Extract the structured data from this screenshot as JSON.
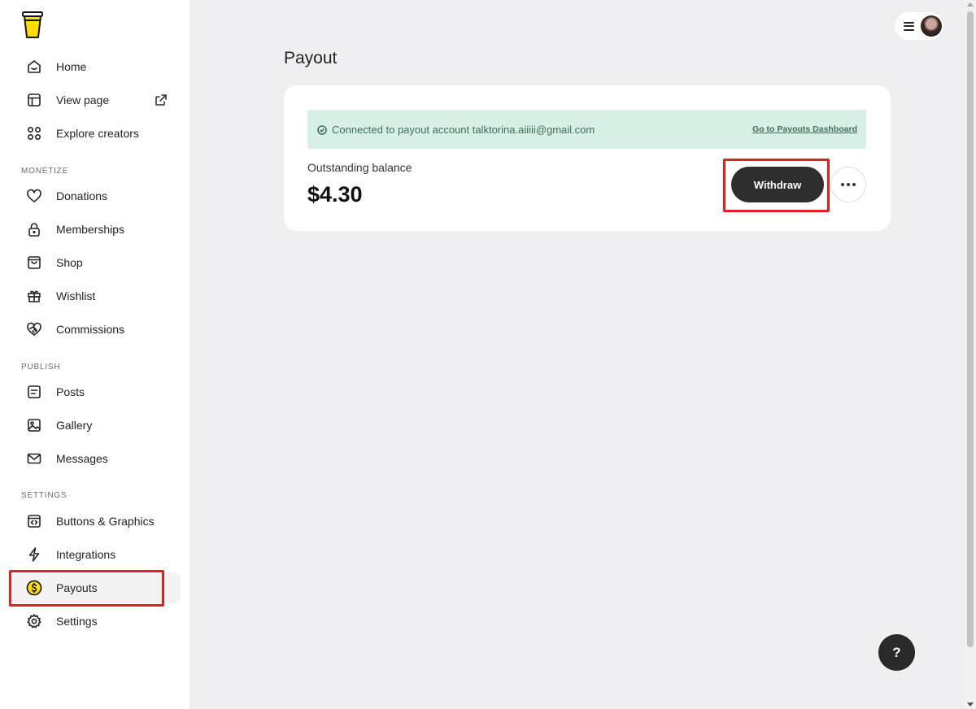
{
  "sidebar": {
    "logo": "buy-me-a-coffee-cup-logo",
    "top_items": [
      {
        "label": "Home",
        "icon": "home-icon"
      },
      {
        "label": "View page",
        "icon": "layout-icon"
      },
      {
        "label": "Explore creators",
        "icon": "grid-circles-icon"
      }
    ],
    "sections": [
      {
        "title": "MONETIZE",
        "items": [
          {
            "label": "Donations",
            "icon": "heart-icon"
          },
          {
            "label": "Memberships",
            "icon": "lock-icon"
          },
          {
            "label": "Shop",
            "icon": "shopping-bag-icon"
          },
          {
            "label": "Wishlist",
            "icon": "gift-icon"
          },
          {
            "label": "Commissions",
            "icon": "handshake-icon"
          }
        ]
      },
      {
        "title": "PUBLISH",
        "items": [
          {
            "label": "Posts",
            "icon": "document-icon"
          },
          {
            "label": "Gallery",
            "icon": "image-icon"
          },
          {
            "label": "Messages",
            "icon": "mail-icon"
          }
        ]
      },
      {
        "title": "SETTINGS",
        "items": [
          {
            "label": "Buttons & Graphics",
            "icon": "code-window-icon"
          },
          {
            "label": "Integrations",
            "icon": "lightning-icon"
          },
          {
            "label": "Payouts",
            "icon": "dollar-coin-icon",
            "active": true
          },
          {
            "label": "Settings",
            "icon": "gear-icon"
          }
        ]
      }
    ]
  },
  "main": {
    "title": "Payout",
    "banner": {
      "text": "Connected to payout account talktorina.aiiiii@gmail.com",
      "link": "Go to Payouts Dashboard"
    },
    "balance": {
      "label": "Outstanding balance",
      "amount": "$4.30"
    },
    "withdraw_label": "Withdraw"
  },
  "help_label": "?",
  "colors": {
    "highlight": "#e41f1f",
    "banner_bg": "#d8efe5",
    "banner_text": "#3e6f5a",
    "button_dark": "#2e2e2e",
    "coin_yellow": "#ffdd00"
  }
}
